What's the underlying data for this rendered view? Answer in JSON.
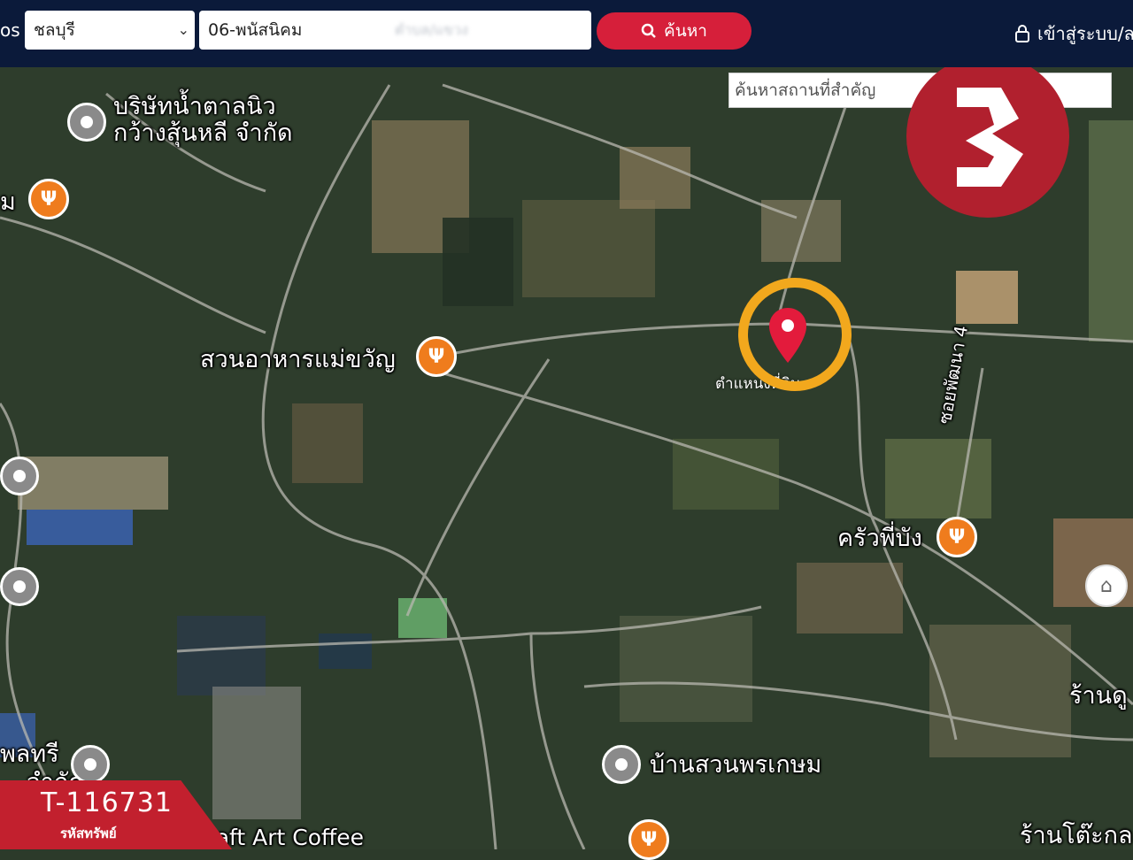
{
  "header": {
    "left_cut_label": "os",
    "province": "ชลบุรี",
    "district": "06-พนัสนิคม",
    "subdistrict_blurred": "ตำบล/แขวง",
    "search_button": "ค้นหา",
    "login": "เข้าสู่ระบบ/ล",
    "icons": {
      "search": "search-icon",
      "lock": "lock-icon",
      "chevron": "chevron-down-icon"
    }
  },
  "map": {
    "place_search_placeholder": "ค้นหาสถานที่สำคัญ",
    "target_label": "ตำแหน่งที่ดิน",
    "road_label": "ซอยพัฒนา 4",
    "pois": {
      "company": "บริษัทน้ำตาลนิว\nกว้างสุ้นหลี จำกัด",
      "left_cut": "ม",
      "restaurant1": "สวนอาหารแม่ขวัญ",
      "restaurant2": "ครัวพี่บัง",
      "village": "บ้านสวนพรเกษม",
      "shop_right": "ร้านดู",
      "bottom_left": "พลทรี",
      "bottom_left2": "จำกัด",
      "coffee": "Craft Art Coffee",
      "bottom_right": "ร้านโต๊ะกล"
    }
  },
  "badge": {
    "code": "T-116731",
    "sub": "รหัสทรัพย์"
  },
  "colors": {
    "topbar": "#0b1a3a",
    "accent": "#d61f3a",
    "ring": "#f2a81d",
    "logo": "#b1202e"
  }
}
